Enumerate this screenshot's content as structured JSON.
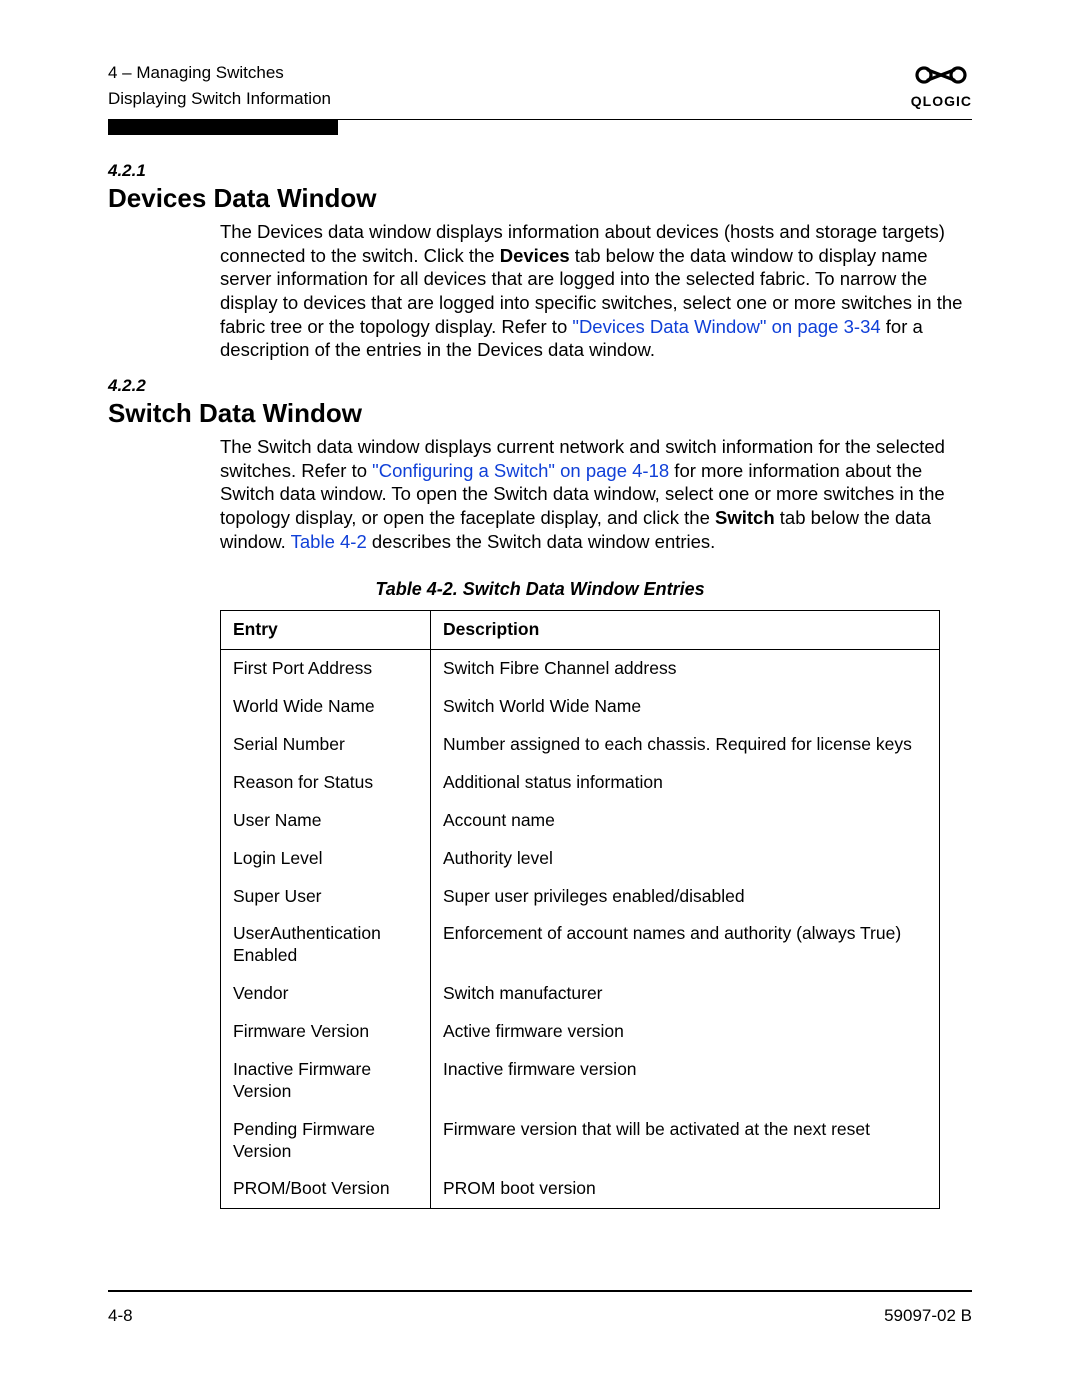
{
  "header": {
    "line1": "4 – Managing Switches",
    "line2": "Displaying Switch Information",
    "logo_glyph": "✕",
    "logo_text": "QLOGIC"
  },
  "s421": {
    "num": "4.2.1",
    "title": "Devices Data Window",
    "p1a": "The Devices data window displays information about devices (hosts and storage targets) connected to the switch. Click the ",
    "p1b_bold": "Devices",
    "p1c": " tab below the data window to display name server information for all devices that are logged into the selected fabric. To narrow the display to devices that are logged into specific switches, select one or more switches in the fabric tree or the topology display. Refer to ",
    "p1d_link": "\"Devices Data Window\" on page 3-34",
    "p1e": " for a description of the entries in the Devices data window."
  },
  "s422": {
    "num": "4.2.2",
    "title": "Switch Data Window",
    "p1a": "The Switch data window displays current network and switch information for the selected switches. Refer to ",
    "p1b_link": "\"Configuring a Switch\" on page 4-18",
    "p1c": " for more information about the Switch data window. To open the Switch data window, select one or more switches in the topology display, or open the faceplate display, and click the ",
    "p1d_bold": "Switch",
    "p1e": " tab below the data window. ",
    "p1f_link": "Table 4-2",
    "p1g": " describes the Switch data window entries."
  },
  "table": {
    "caption": "Table 4-2. Switch Data Window Entries",
    "head_entry": "Entry",
    "head_desc": "Description",
    "rows": [
      {
        "e": "First Port Address",
        "d": "Switch Fibre Channel address"
      },
      {
        "e": "World Wide Name",
        "d": "Switch World Wide Name"
      },
      {
        "e": "Serial Number",
        "d": "Number assigned to each chassis. Required for license keys"
      },
      {
        "e": "Reason for Status",
        "d": "Additional status information"
      },
      {
        "e": "User Name",
        "d": "Account name"
      },
      {
        "e": "Login Level",
        "d": "Authority level"
      },
      {
        "e": "Super User",
        "d": "Super user privileges enabled/disabled"
      },
      {
        "e": "UserAuthentication Enabled",
        "d": "Enforcement of account names and authority (always True)"
      },
      {
        "e": "Vendor",
        "d": "Switch manufacturer"
      },
      {
        "e": "Firmware Version",
        "d": "Active firmware version"
      },
      {
        "e": "Inactive Firmware Version",
        "d": "Inactive firmware version"
      },
      {
        "e": "Pending Firmware Version",
        "d": "Firmware version that will be activated at the next reset"
      },
      {
        "e": "PROM/Boot Version",
        "d": "PROM boot version"
      }
    ]
  },
  "footer": {
    "left": "4-8",
    "right": "59097-02 B"
  }
}
